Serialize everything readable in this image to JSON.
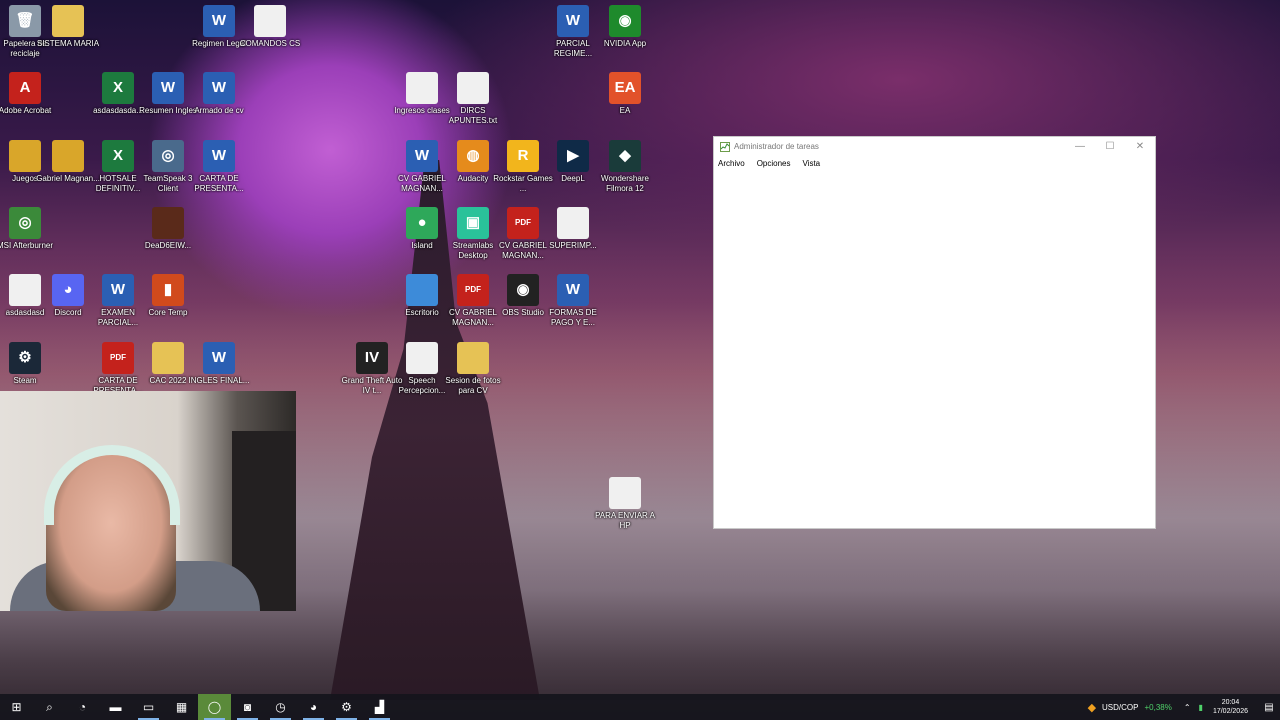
{
  "desktop_icons": [
    {
      "label": "Papelera de reciclaje",
      "glyph": "🗑",
      "color": "#8a99a8"
    },
    {
      "label": "SISTEMA MARIA",
      "glyph": "",
      "color": "#e6c255"
    },
    {
      "label": "Regimen Legal",
      "glyph": "W",
      "color": "#2b5fb3"
    },
    {
      "label": "COMANDOS CS",
      "glyph": "",
      "color": "#f0f0f0"
    },
    {
      "label": "PARCIAL REGIME...",
      "glyph": "W",
      "color": "#2b5fb3"
    },
    {
      "label": "NVIDIA App",
      "glyph": "◉",
      "color": "#1e8a2c"
    },
    {
      "label": "Adobe Acrobat",
      "glyph": "A",
      "color": "#c4221c"
    },
    {
      "label": "asdasdasda...",
      "glyph": "X",
      "color": "#1d7a3e"
    },
    {
      "label": "Resumen Ingles",
      "glyph": "W",
      "color": "#2b5fb3"
    },
    {
      "label": "Armado de cv",
      "glyph": "W",
      "color": "#2b5fb3"
    },
    {
      "label": "Ingresos clases",
      "glyph": "",
      "color": "#f0f0f0"
    },
    {
      "label": "DIRCS APUNTES.txt",
      "glyph": "",
      "color": "#f0f0f0"
    },
    {
      "label": "EA",
      "glyph": "EA",
      "color": "#e2522a"
    },
    {
      "label": "Juegos",
      "glyph": "",
      "color": "#d9a62a"
    },
    {
      "label": "Gabriel Magnan...",
      "glyph": "",
      "color": "#d9a62a"
    },
    {
      "label": "HOTSALE DEFINITIV...",
      "glyph": "X",
      "color": "#1d7a3e"
    },
    {
      "label": "TeamSpeak 3 Client",
      "glyph": "◎",
      "color": "#4a6a8c"
    },
    {
      "label": "CARTA DE PRESENTA...",
      "glyph": "W",
      "color": "#2b5fb3"
    },
    {
      "label": "CV GABRIEL MAGNAN...",
      "glyph": "W",
      "color": "#2b5fb3"
    },
    {
      "label": "Audacity",
      "glyph": "◍",
      "color": "#e58b1c"
    },
    {
      "label": "Rockstar Games ...",
      "glyph": "R",
      "color": "#f2b51c"
    },
    {
      "label": "DeepL",
      "glyph": "▶",
      "color": "#0f2a47"
    },
    {
      "label": "Wondershare Filmora 12",
      "glyph": "◆",
      "color": "#1a3b3a"
    },
    {
      "label": "MSI Afterburner",
      "glyph": "◎",
      "color": "#3b8a3a"
    },
    {
      "label": "DeaD6EIW...",
      "glyph": "",
      "color": "#5a2a1a"
    },
    {
      "label": "Island",
      "glyph": "●",
      "color": "#2ea85a"
    },
    {
      "label": "Streamlabs Desktop",
      "glyph": "▣",
      "color": "#2ac29a"
    },
    {
      "label": "CV GABRIEL MAGNAN...",
      "glyph": "PDF",
      "color": "#c4221c"
    },
    {
      "label": "SUPERIMP...",
      "glyph": "",
      "color": "#f0f0f0"
    },
    {
      "label": "asdasdasd",
      "glyph": "",
      "color": "#f0f0f0"
    },
    {
      "label": "Discord",
      "glyph": "◕",
      "color": "#5865f2"
    },
    {
      "label": "EXAMEN PARCIAL...",
      "glyph": "W",
      "color": "#2b5fb3"
    },
    {
      "label": "Core Temp",
      "glyph": "▮",
      "color": "#d14a1c"
    },
    {
      "label": "Escritorio",
      "glyph": "",
      "color": "#3d8bd9"
    },
    {
      "label": "CV GABRIEL MAGNAN...",
      "glyph": "PDF",
      "color": "#c4221c"
    },
    {
      "label": "OBS Studio",
      "glyph": "◉",
      "color": "#222"
    },
    {
      "label": "FORMAS DE PAGO Y E...",
      "glyph": "W",
      "color": "#2b5fb3"
    },
    {
      "label": "Steam",
      "glyph": "⚙",
      "color": "#1b2838"
    },
    {
      "label": "CARTA DE PRESENTA...",
      "glyph": "PDF",
      "color": "#c4221c"
    },
    {
      "label": "CAC 2022",
      "glyph": "",
      "color": "#e6c255"
    },
    {
      "label": "INGLES FINAL...",
      "glyph": "W",
      "color": "#2b5fb3"
    },
    {
      "label": "Grand Theft Auto IV t...",
      "glyph": "IV",
      "color": "#222"
    },
    {
      "label": "Speech Percepcion...",
      "glyph": "",
      "color": "#f0f0f0"
    },
    {
      "label": "Sesion de fotos para CV",
      "glyph": "",
      "color": "#e6c255"
    },
    {
      "label": "PARA ENVIAR A HP",
      "glyph": "",
      "color": "#f0f0f0"
    }
  ],
  "window": {
    "title": "Administrador de tareas",
    "menu": [
      "Archivo",
      "Opciones",
      "Vista"
    ],
    "minimize": "—",
    "maximize": "☐",
    "close": "✕"
  },
  "taskbar": {
    "items": [
      {
        "name": "start-button",
        "glyph": "⊞"
      },
      {
        "name": "search-button",
        "glyph": "⌕"
      },
      {
        "name": "chrome-taskbar",
        "glyph": "◔"
      },
      {
        "name": "terminal-taskbar",
        "glyph": "▬"
      },
      {
        "name": "file-explorer-taskbar",
        "glyph": "▭"
      },
      {
        "name": "calculator-taskbar",
        "glyph": "▦"
      },
      {
        "name": "opera-taskbar",
        "glyph": "◯"
      },
      {
        "name": "outlook-taskbar",
        "glyph": "◙"
      },
      {
        "name": "clock-app-taskbar",
        "glyph": "◷"
      },
      {
        "name": "chrome-profile-taskbar",
        "glyph": "◕"
      },
      {
        "name": "steam-taskbar",
        "glyph": "⚙"
      },
      {
        "name": "task-manager-taskbar",
        "glyph": "▟"
      }
    ],
    "stock_label": "USD/COP",
    "stock_change": "+0,38%",
    "time": "20:04",
    "date": "17/02/2026"
  }
}
